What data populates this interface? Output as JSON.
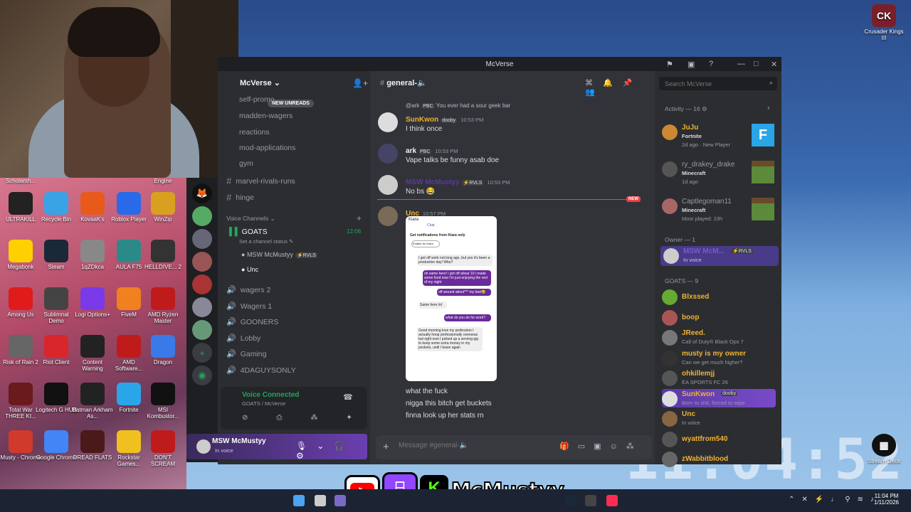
{
  "window": {
    "title": "McVerse"
  },
  "server": {
    "name": "McVerse",
    "new_unreads": "NEW UNREADS"
  },
  "channels": [
    {
      "name": "self-promo"
    },
    {
      "name": "madden-wagers"
    },
    {
      "name": "reactions"
    },
    {
      "name": "mod-applications"
    },
    {
      "name": "gym"
    },
    {
      "name": "marvel-rivals-runs"
    },
    {
      "name": "hinge"
    }
  ],
  "voice": {
    "header": "Voice Channels",
    "goats": {
      "name": "GOATS",
      "status": "Set a channel status",
      "timer": "12:06",
      "members": [
        {
          "name": "MSW McMustyy",
          "tag": "RVLS"
        },
        {
          "name": "Unc"
        }
      ]
    },
    "others": [
      "wagers 2",
      "Wagers 1",
      "GOONERS",
      "Lobby",
      "Gaming",
      "4DAGUYSONLY"
    ]
  },
  "voice_connected": {
    "title": "Voice Connected",
    "sub": "GOATS / McVerse"
  },
  "user": {
    "name": "MSW McMustyy",
    "status": "In voice"
  },
  "chat": {
    "channel": "general-🔈",
    "reply": {
      "user": "@ark",
      "tag": "PBC",
      "text": "You ever had a sour geek bar"
    },
    "messages": [
      {
        "user": "SunKwon",
        "tag": "dooby",
        "time": "10:53 PM",
        "lines": [
          "I think once"
        ]
      },
      {
        "user": "ark",
        "tag": "PBC",
        "time": "10:53 PM",
        "lines": [
          "Vape talks be funny asab doe"
        ]
      },
      {
        "user": "MSW McMustyy",
        "tag": "RVLS",
        "time": "10:53 PM",
        "lines": [
          "No bs 😂"
        ]
      },
      {
        "user": "Unc",
        "time": "10:57 PM",
        "lines": [
          "what the fuck",
          "nigga this bitch get buckets",
          "finna look up her stats rn"
        ]
      }
    ],
    "new_label": "NEW",
    "placeholder": "Message #general-🔈",
    "embed": {
      "title": "Kiara",
      "tab": "Chat",
      "notif": "Get notifications from Kiara only",
      "btn": "Enable for Kiara",
      "b1": "I got off work not long ago, but yes it's been a productive day! Wbu?",
      "b2": "oh same here! i got off about 10 i made some food now I'm just enjoying the rest of my night",
      "b3": "off around about*** my bad😂",
      "b4": "Same here lol",
      "b5": "what do you do for work?",
      "b6": "Good morning love my profession I actually hoop professionally overseas but right now I picked up a serving gig to keep some extra money in my pockets, until I leave again"
    }
  },
  "search": {
    "placeholder": "Search McVerse"
  },
  "members": {
    "activity_header": "Activity — 16",
    "activity": [
      {
        "name": "JuJu",
        "game": "Fortnite",
        "detail": "2d ago · New Player"
      },
      {
        "name": "ry_drakey_drake",
        "game": "Minecraft",
        "detail": "1d ago"
      },
      {
        "name": "Captlegoman11",
        "game": "Minecraft",
        "detail": "Most played: 23h"
      }
    ],
    "owner_header": "Owner — 1",
    "owner": {
      "name": "MSW McM...",
      "tag": "RVLS",
      "status": "In voice"
    },
    "goats_header": "GOATS — 9",
    "goats": [
      {
        "name": "Blxssed",
        "status": ""
      },
      {
        "name": "boop",
        "status": ""
      },
      {
        "name": "JReed.",
        "status": "Call of Duty® Black Ops 7"
      },
      {
        "name": "musty is my owner",
        "status": "Can we get much higher?"
      },
      {
        "name": "ohkillemjj",
        "status": "EA SPORTS FC 26"
      },
      {
        "name": "SunKwon",
        "tag": "dooby",
        "status": "Born to shit, forced to wipe"
      },
      {
        "name": "Unc",
        "status": "In voice"
      },
      {
        "name": "wyattfrom540",
        "status": ""
      },
      {
        "name": "zWabbitblood",
        "status": ""
      }
    ]
  },
  "desktop": {
    "icons": [
      "ULTRAKILL",
      "Recycle Bin",
      "KovaaK's",
      "Roblox Player",
      "WinZip",
      "Megabonk",
      "Steam",
      "1qZDkca",
      "AULA F75",
      "HELLDIVE... 2",
      "Among Us",
      "Sublimnal Demo",
      "Logi Options+",
      "FiveM",
      "AMD Ryzen Master",
      "Risk of Rain 2",
      "Riot Client",
      "Content Warning",
      "AMD Software...",
      "Dragon",
      "Total War THREE KI...",
      "Logitech G HUB",
      "Batman Arkham As...",
      "Fortnite",
      "MSI Kombustor...",
      "Musty - Chrome",
      "Google Chrome",
      "DREAD FLATS",
      "Rockstar Games...",
      "DON'T SCREAM"
    ],
    "top_left": "Scholarsh...",
    "top_right": "Engine",
    "right_icons": [
      "Crusader Kings III",
      "Stream Deck"
    ]
  },
  "overlay": {
    "name": "McMustyy"
  },
  "clock": {
    "big": "11:04:52",
    "time": "11:04 PM",
    "date": "1/11/2026"
  }
}
